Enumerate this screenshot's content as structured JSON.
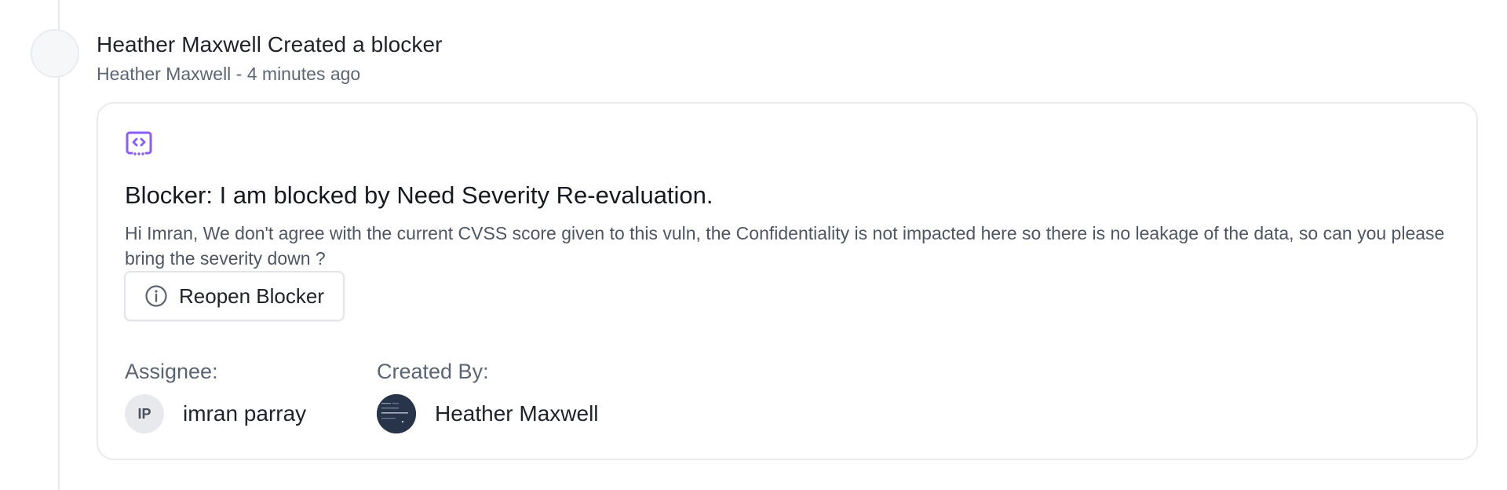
{
  "event": {
    "title": "Heather Maxwell Created a blocker",
    "meta": "Heather Maxwell - 4 minutes ago"
  },
  "blocker": {
    "icon": "code-block-icon",
    "title": "Blocker: I am blocked by Need Severity Re-evaluation.",
    "description": "Hi Imran, We don't agree with the current CVSS score given to this vuln, the Confidentiality is not impacted here so there is no leakage of the data, so can you please bring the severity down ?",
    "reopen_label": "Reopen Blocker",
    "reopen_icon": "info-circle-icon"
  },
  "assignee": {
    "label": "Assignee:",
    "initials": "IP",
    "name": "imran parray"
  },
  "created_by": {
    "label": "Created By:",
    "name": "Heather Maxwell"
  },
  "colors": {
    "accent_purple": "#8b5cf6",
    "avatar_dark": "#283449"
  }
}
